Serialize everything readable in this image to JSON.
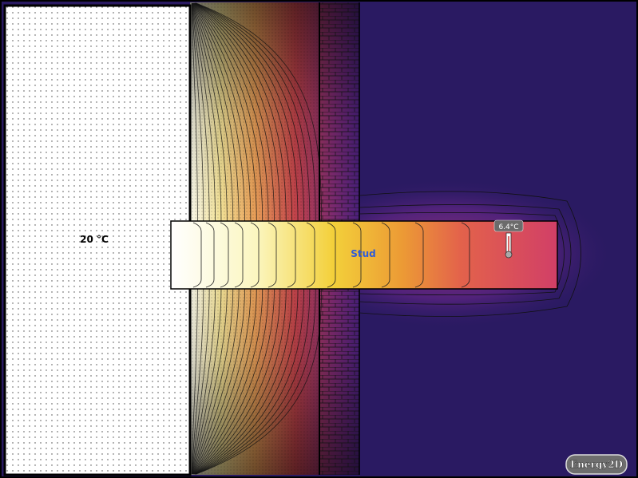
{
  "heater": {
    "label": "20 °C"
  },
  "stud": {
    "label": "Stud"
  },
  "thermometer": {
    "reading": "6.4°C"
  },
  "logo": {
    "text": "Energy2D"
  },
  "colors": {
    "cold": "#2a1a62",
    "warm": "#ffffff",
    "stud_label": "#2f5bd8",
    "frame": "#000000"
  }
}
